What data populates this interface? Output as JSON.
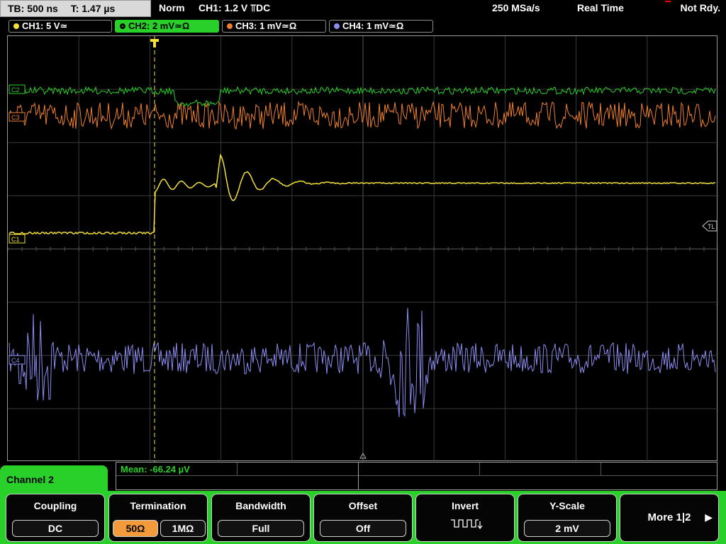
{
  "status": {
    "timebase": "TB: 500 ns",
    "trigger_time": "T: 1.47 µs",
    "mode": "Norm",
    "trigger": "CH1: 1.2 V ⫪DC",
    "sample_rate": "250 MSa/s",
    "acq_mode": "Real Time",
    "state": "Not Rdy."
  },
  "channels": [
    {
      "label": "CH1: 5 V≃",
      "color": "#f4e23a"
    },
    {
      "label": "CH2: 2 mV≃Ω",
      "color": "#2ad02a"
    },
    {
      "label": "CH3: 1 mV≃Ω",
      "color": "#f08030"
    },
    {
      "label": "CH4: 1 mV≃Ω",
      "color": "#8c8cf0"
    }
  ],
  "markers": {
    "ch1": "C1",
    "ch2": "C2",
    "ch3": "C3",
    "ch4": "C4",
    "trigger_level": "TL",
    "trigger": "T"
  },
  "measurement": {
    "text": "Mean: -66.24 µV"
  },
  "menu": {
    "title": "Channel 2",
    "coupling": {
      "label": "Coupling",
      "value": "DC"
    },
    "termination": {
      "label": "Termination",
      "opt1": "50Ω",
      "opt2": "1MΩ"
    },
    "bandwidth": {
      "label": "Bandwidth",
      "value": "Full"
    },
    "offset": {
      "label": "Offset",
      "value": "Off"
    },
    "invert": {
      "label": "Invert",
      "icon": "square-wave-invert-icon"
    },
    "yscale": {
      "label": "Y-Scale",
      "value": "2 mV"
    },
    "more": {
      "label": "More 1|2"
    }
  },
  "colors": {
    "accent": "#2ad02a",
    "ch1": "#f4e23a",
    "ch2": "#2ad02a",
    "ch3": "#f08030",
    "ch4": "#8c8cf0",
    "selected": "#f39b3a"
  }
}
